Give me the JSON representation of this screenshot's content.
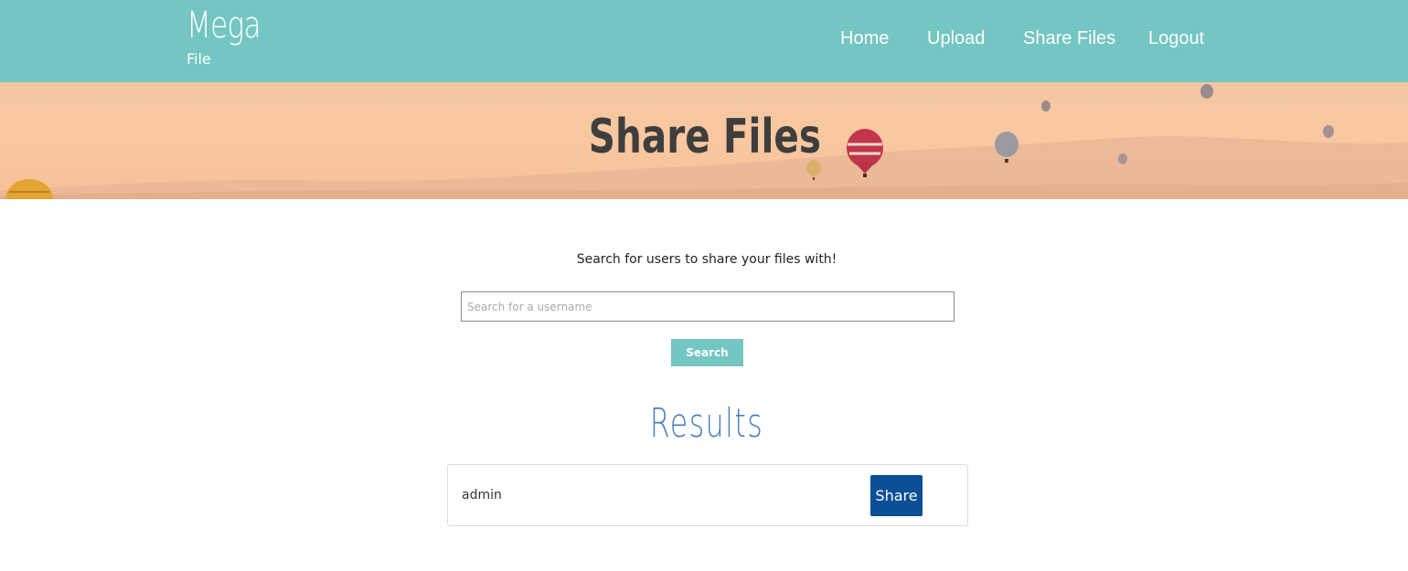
{
  "header": {
    "logo_main": "Mega",
    "logo_sub": "File",
    "nav": {
      "home": "Home",
      "upload": "Upload",
      "share_files": "Share Files",
      "logout": "Logout"
    }
  },
  "hero": {
    "title": "Share Files"
  },
  "search": {
    "intro_text": "Search for users to share your files with!",
    "placeholder": "Search for a username",
    "value": "",
    "button_label": "Search"
  },
  "results": {
    "heading": "Results",
    "items": [
      {
        "username": "admin",
        "action_label": "Share"
      }
    ]
  },
  "colors": {
    "navbar": "#73c6c1",
    "search_button": "#73c6c1",
    "share_button": "#0b4f95",
    "results_heading": "#4a7ec0"
  }
}
